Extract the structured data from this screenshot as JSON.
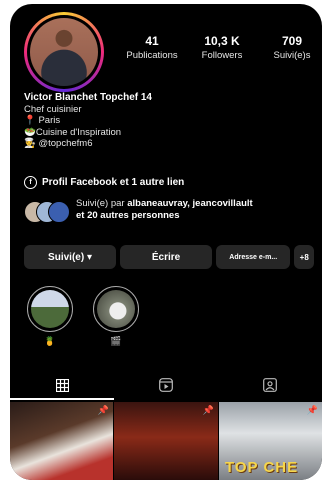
{
  "profile": {
    "stats": [
      {
        "num": "41",
        "label": "Publications"
      },
      {
        "num": "10,3 K",
        "label": "Followers"
      },
      {
        "num": "709",
        "label": "Suivi(e)s"
      }
    ],
    "name": "Victor Blanchet Topchef 14",
    "bio_lines": [
      "Chef cuisinier",
      "📍 Paris",
      "🥗Cuisine d'Inspiration",
      "👨‍🍳 @topchefm6"
    ],
    "external_link": "Profil Facebook et 1 autre lien",
    "followed_by": {
      "line1_prefix": "Suivi(e) par ",
      "line1_names": "albaneauvray, jeancovillault",
      "line2": "et 20 autres personnes"
    }
  },
  "buttons": {
    "follow": "Suivi(e) ▾",
    "message": "Écrire",
    "email": "Adresse e-m...",
    "add_user": "+8"
  },
  "highlights": [
    {
      "label": "🍍"
    },
    {
      "label": "🎬"
    }
  ],
  "tabs": [
    "grid-icon",
    "reels-icon",
    "tagged-icon"
  ],
  "grid": {
    "posts": [
      {
        "pinned": true
      },
      {
        "pinned": true
      },
      {
        "pinned": true,
        "overlay_text": "TOP CHE"
      }
    ]
  },
  "colors": {
    "background": "#000000",
    "button": "#262626",
    "text": "#ffffff",
    "accent_gold": "#f6d64b"
  }
}
